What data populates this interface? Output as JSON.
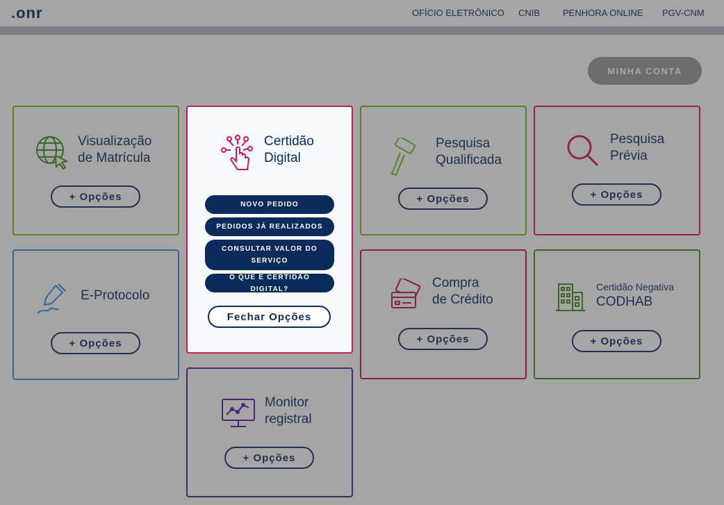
{
  "logo": {
    "text": ".onr"
  },
  "nav": [
    "OFÍCIO ELETRÔNICO",
    "CNIB",
    "PENHORA ONLINE",
    "PGV-CNM"
  ],
  "account_button": "MINHA CONTA",
  "cards": {
    "matricula": {
      "title": [
        "Visualização",
        "de Matrícula"
      ],
      "button": "+ Opções",
      "color": "#6fbf2a"
    },
    "certidao": {
      "title": [
        "Certidão",
        "Digital"
      ],
      "color": "#c8195a",
      "menu": [
        "NOVO PEDIDO",
        "PEDIDOS JÁ REALIZADOS",
        "CONSULTAR VALOR DO SERVIÇO",
        "O QUE É CERTIDÃO DIGITAL?"
      ],
      "close_button": "Fechar Opções"
    },
    "qualificada": {
      "title": [
        "Pesquisa",
        "Qualificada"
      ],
      "button": "+ Opções",
      "color": "#6fbf2a"
    },
    "previa": {
      "title": [
        "Pesquisa",
        "Prévia"
      ],
      "button": "+ Opções",
      "color": "#d3185e"
    },
    "eprotocolo": {
      "title": [
        "E-Protocolo"
      ],
      "button": "+ Opções",
      "color": "#3a8fd6"
    },
    "credito": {
      "title": [
        "Compra",
        "de Crédito"
      ],
      "button": "+ Opções",
      "color": "#c0173f"
    },
    "codhab": {
      "title": [
        "Certidão Negativa",
        "CODHAB"
      ],
      "button": "+ Opções",
      "color": "#3f8a22"
    },
    "monitor": {
      "title": [
        "Monitor",
        "registral"
      ],
      "button": "+ Opções",
      "color": "#5a1a9a"
    }
  }
}
